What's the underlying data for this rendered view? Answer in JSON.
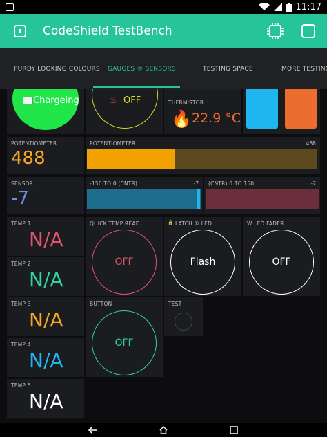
{
  "status": {
    "time": "11:17"
  },
  "app": {
    "title": "CodeShield TestBench"
  },
  "tabs": [
    "PURDY LOOKING COLOURS",
    "GAUGES ® SENSORS",
    "TESTING SPACE",
    "MORE TESTING SP"
  ],
  "widgets": {
    "charging": {
      "label": "Chargeing"
    },
    "alarm": {
      "value": "OFF"
    },
    "thermistor": {
      "label": "THERMISTOR",
      "value": "22.9 °C"
    },
    "potentiometer_value": {
      "label": "POTENTIOMETER",
      "value": "488"
    },
    "potentiometer_bar": {
      "label": "POTENTIOMETER",
      "value": "488",
      "fraction": 0.38
    },
    "sensor": {
      "label": "SENSOR",
      "value": "-7"
    },
    "neg_bar": {
      "label": "-150 TO 0 (CNTR)",
      "value": "-7"
    },
    "pos_bar": {
      "label": "(CNTR) 0 TO 150",
      "value": "-7"
    },
    "temps": [
      {
        "label": "TEMP 1",
        "value": "N/A",
        "color": "#e0546a"
      },
      {
        "label": "TEMP 2",
        "value": "N/A",
        "color": "#2ed3a0"
      },
      {
        "label": "TEMP 3",
        "value": "N/A",
        "color": "#f5a623"
      },
      {
        "label": "TEMP 4",
        "value": "N/A",
        "color": "#1fb6f0"
      },
      {
        "label": "TEMP 5",
        "value": "N/A",
        "color": "#ffffff"
      }
    ],
    "quick_temp": {
      "label": "QUICK TEMP READ",
      "value": "OFF"
    },
    "latch": {
      "label": "LATCH ® LED",
      "value": "Flash"
    },
    "fader": {
      "label": "W LED FADER",
      "value": "OFF"
    },
    "button": {
      "label": "BUTTON",
      "value": "OFF"
    },
    "test": {
      "label": "TEST"
    }
  },
  "colors": {
    "accent": "#26c49a",
    "blue_tile": "#1fb6f0",
    "orange_tile": "#ec6d2e",
    "green_charge": "#21e64a",
    "gauge_yellow": "#d6e020",
    "pot_orange": "#f2a200",
    "bar_blue": "#1f6d8c",
    "bar_red": "#6b2f3c"
  }
}
